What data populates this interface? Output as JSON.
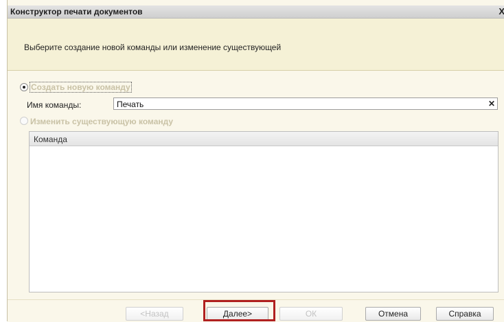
{
  "window": {
    "title": "Конструктор печати документов",
    "close_glyph": "X"
  },
  "header": {
    "text": "Выберите создание новой команды или изменение существующей"
  },
  "options": {
    "create": {
      "label": "Создать новую команду",
      "checked": true
    },
    "change": {
      "label": "Изменить существующую команду",
      "checked": false,
      "disabled": true
    }
  },
  "command_field": {
    "label": "Имя команды:",
    "value": "Печать",
    "clear_glyph": "✕"
  },
  "table": {
    "columns": [
      "Команда"
    ],
    "rows": []
  },
  "buttons": {
    "back": "<Назад",
    "next": "Далее>",
    "ok": "ОК",
    "cancel": "Отмена",
    "help": "Справка"
  },
  "colors": {
    "highlight": "#b01f1f",
    "header_bg": "#f5f1d6",
    "window_bg": "#faf7ea"
  }
}
